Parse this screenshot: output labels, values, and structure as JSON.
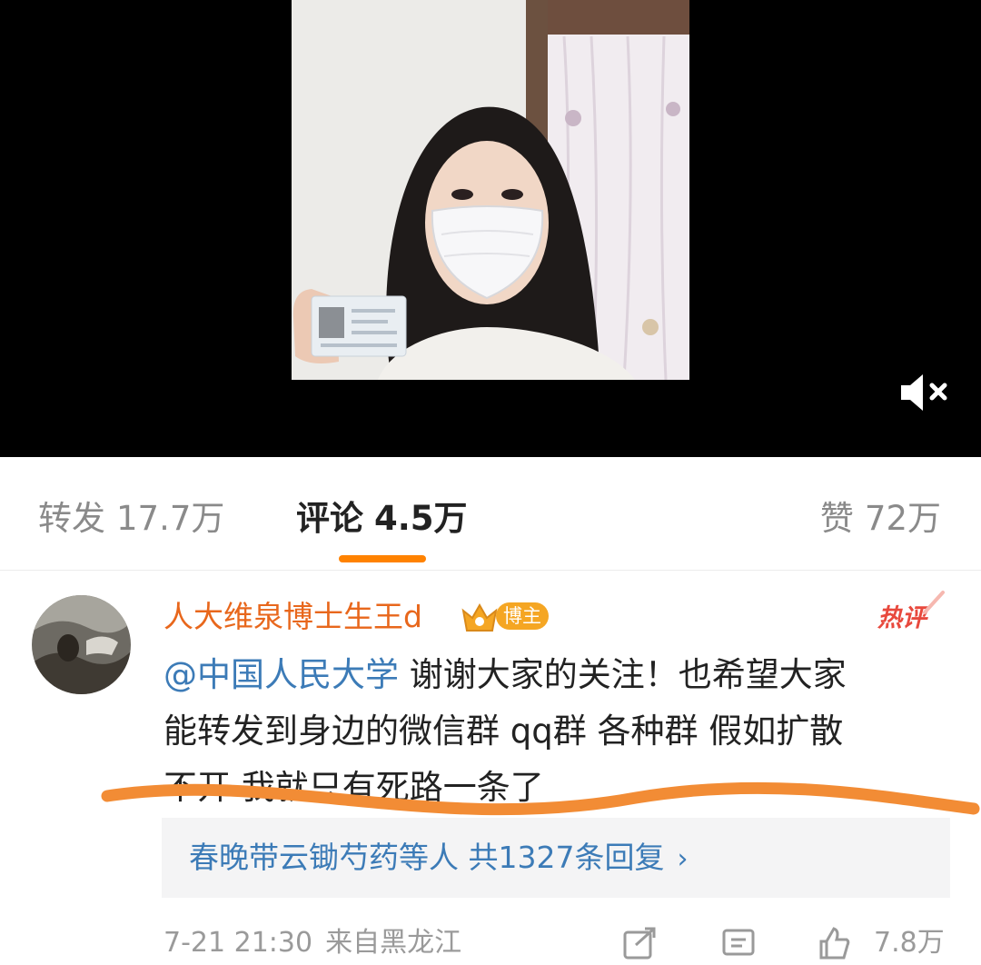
{
  "colors": {
    "accent": "#FF8200",
    "author": "#E8671C",
    "link": "#3C7BB7",
    "badge": "#F5A623",
    "hot": "#E8493D",
    "underline": "#F28C35"
  },
  "video": {
    "mute_icon": "speaker-muted-icon"
  },
  "tabs": [
    {
      "label": "转发",
      "count": "17.7万",
      "active": false
    },
    {
      "label": "评论",
      "count": "4.5万",
      "active": true
    },
    {
      "label": "赞",
      "count": "72万",
      "active": false
    }
  ],
  "comment": {
    "author": "人大维泉博士生王d",
    "badge": "博主",
    "hot_label": "热评",
    "mention": "@中国人民大学",
    "line1_rest": " 谢谢大家的关注！也希望大家",
    "line2": "能转发到身边的微信群 qq群 各种群 假如扩散",
    "line3": "不开 我就只有死路一条了",
    "replies": {
      "names": "春晚带云锄芍药等人",
      "count": "共1327条回复",
      "chevron": "›"
    },
    "footer": {
      "time": "7-21 21:30",
      "location": "来自黑龙江",
      "like_count": "7.8万"
    }
  }
}
